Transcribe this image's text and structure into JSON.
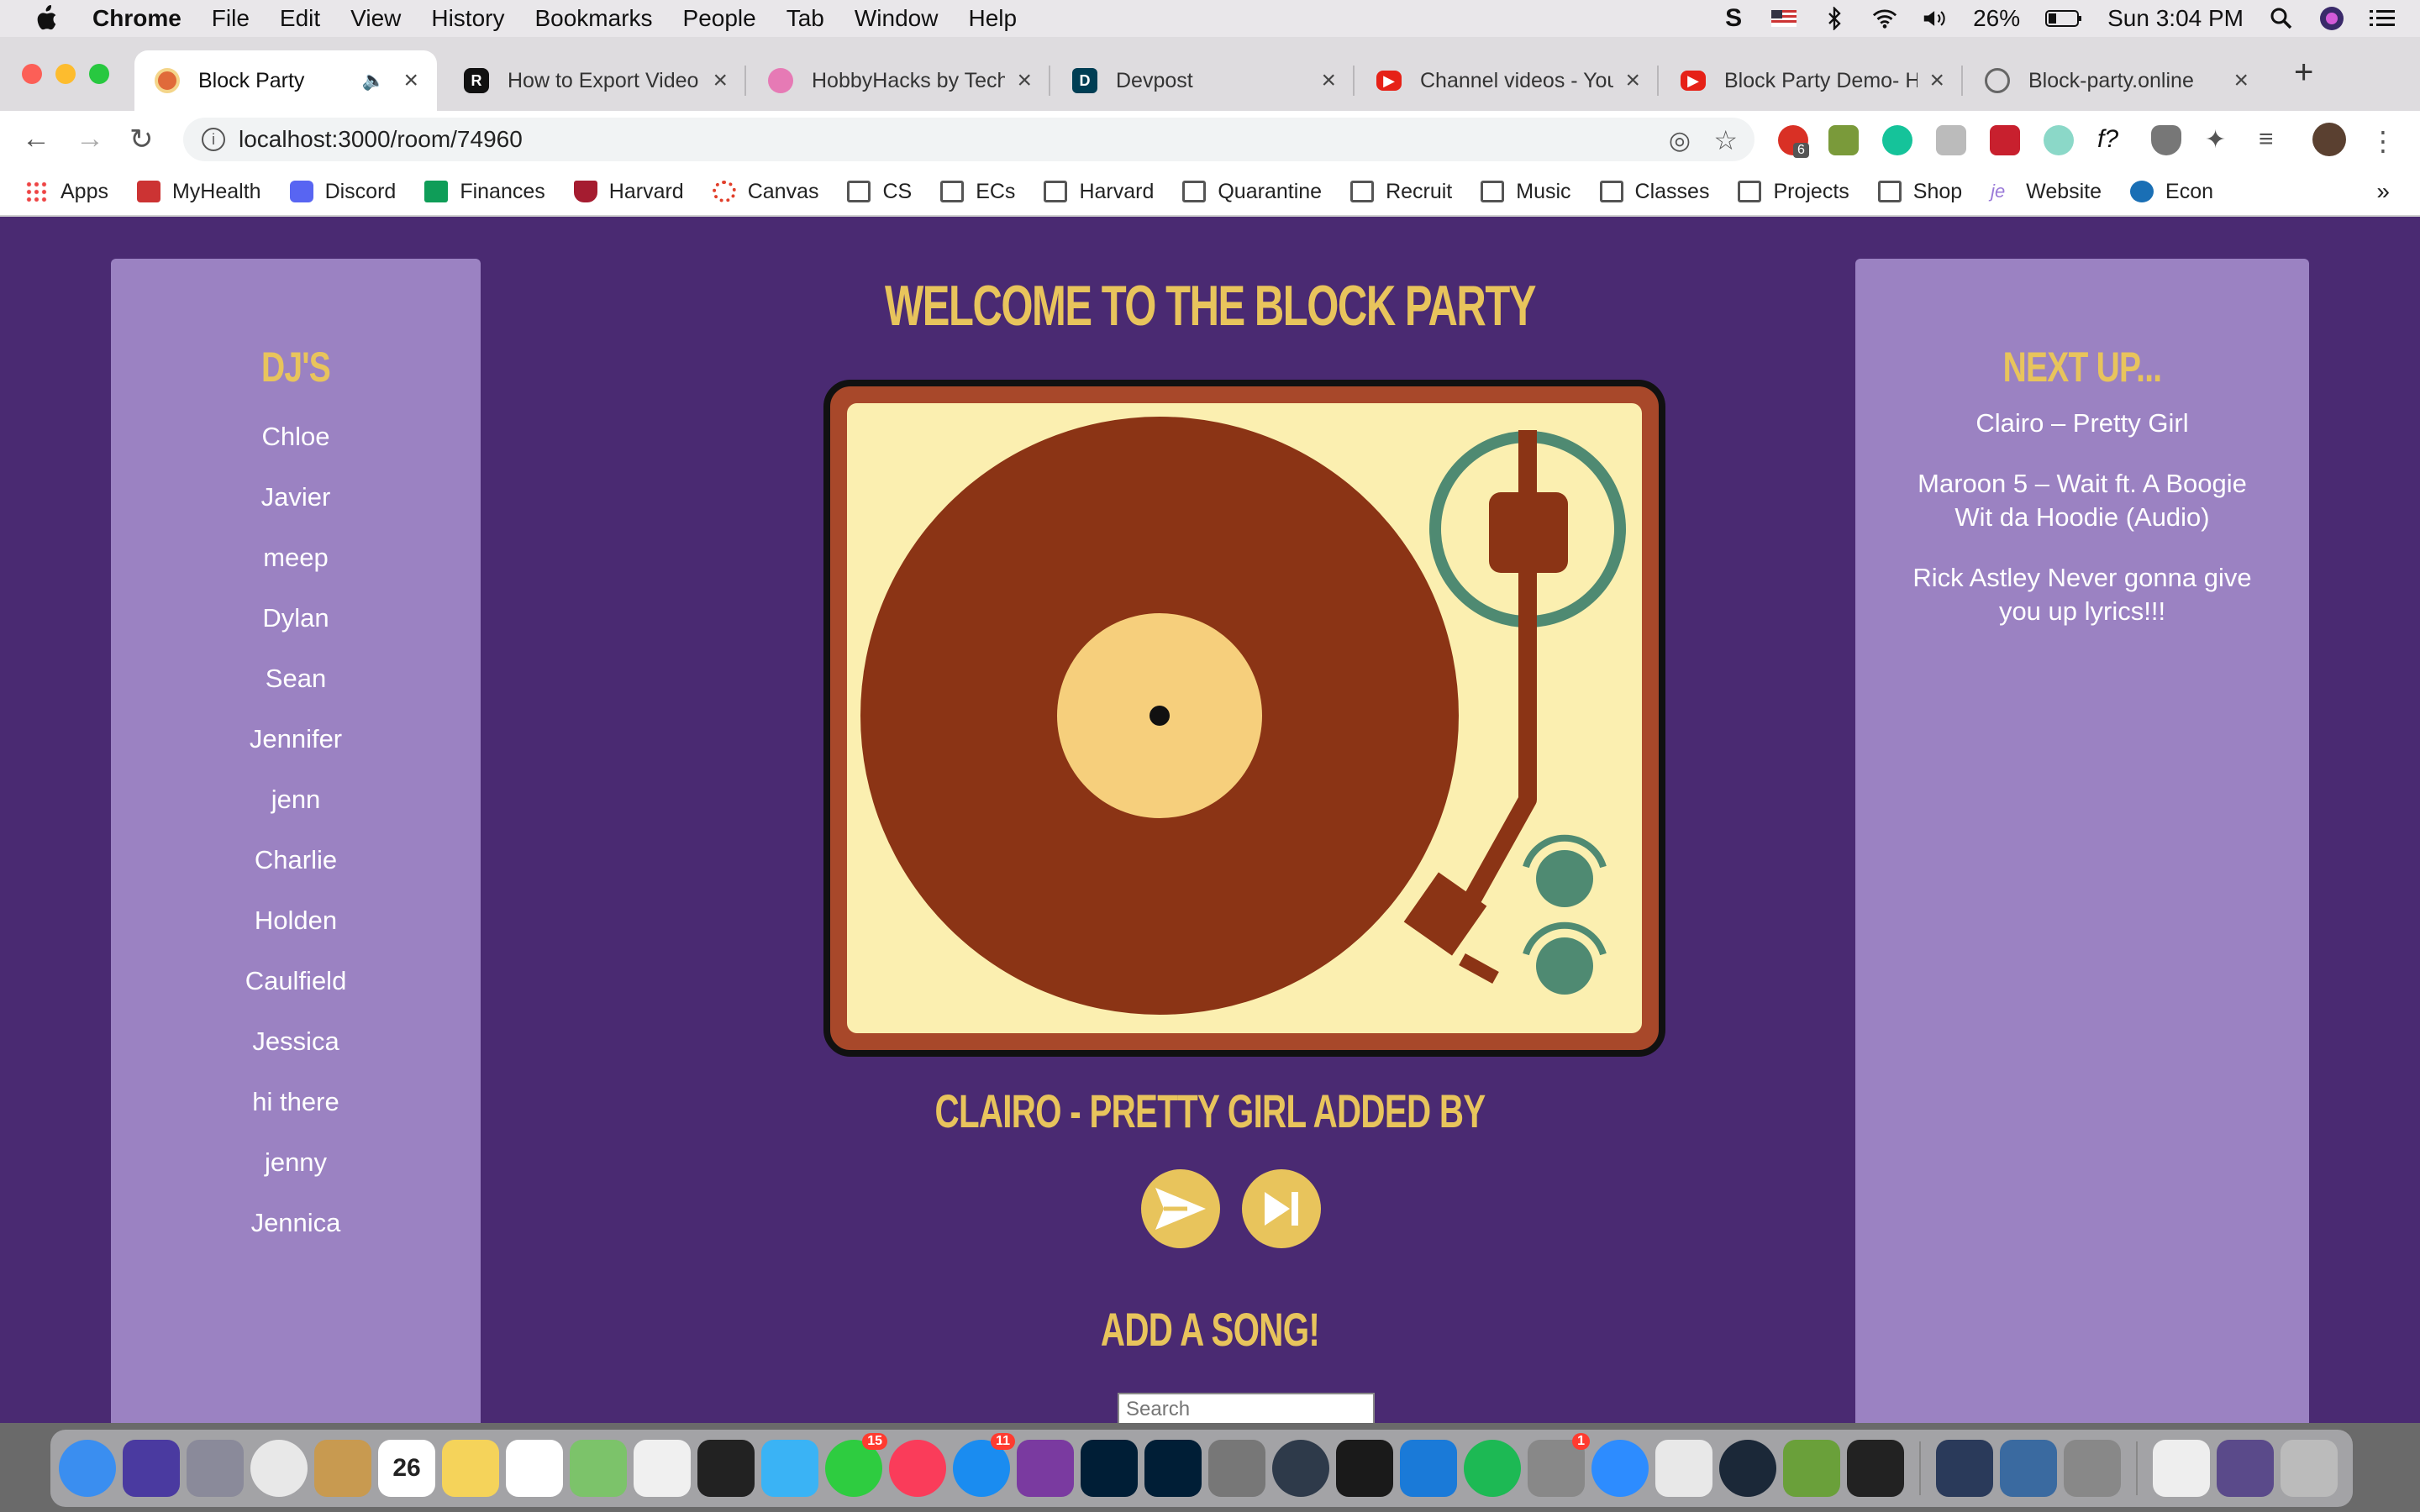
{
  "menubar": {
    "items": [
      "Chrome",
      "File",
      "Edit",
      "View",
      "History",
      "Bookmarks",
      "People",
      "Tab",
      "Window",
      "Help"
    ],
    "battery": "26%",
    "clock": "Sun 3:04 PM"
  },
  "tabs": [
    {
      "title": "Block Party",
      "icon": "block-party-icon",
      "color": "#e06a3a",
      "active": true
    },
    {
      "title": "How to Export Video",
      "icon": "premiere-icon",
      "color": "#111111"
    },
    {
      "title": "HobbyHacks by Tech",
      "icon": "hobbyhacks-icon",
      "color": "#e67ab5"
    },
    {
      "title": "Devpost",
      "icon": "devpost-icon",
      "color": "#003e54"
    },
    {
      "title": "Channel videos - You",
      "icon": "youtube-icon",
      "color": "#e62117"
    },
    {
      "title": "Block Party Demo- H",
      "icon": "youtube-icon",
      "color": "#e62117"
    },
    {
      "title": "Block-party.online",
      "icon": "globe-icon",
      "color": "#666666"
    }
  ],
  "toolbar": {
    "url": "localhost:3000/room/74960",
    "extension_badge": "6"
  },
  "bookmarks": [
    {
      "label": "Apps",
      "icon": "apps-grid-icon"
    },
    {
      "label": "MyHealth",
      "icon": "myhealth-icon"
    },
    {
      "label": "Discord",
      "icon": "discord-icon"
    },
    {
      "label": "Finances",
      "icon": "sheets-icon"
    },
    {
      "label": "Harvard",
      "icon": "harvard-icon"
    },
    {
      "label": "Canvas",
      "icon": "canvas-icon"
    },
    {
      "label": "CS",
      "icon": "folder-icon"
    },
    {
      "label": "ECs",
      "icon": "folder-icon"
    },
    {
      "label": "Harvard",
      "icon": "folder-icon"
    },
    {
      "label": "Quarantine",
      "icon": "folder-icon"
    },
    {
      "label": "Recruit",
      "icon": "folder-icon"
    },
    {
      "label": "Music",
      "icon": "folder-icon"
    },
    {
      "label": "Classes",
      "icon": "folder-icon"
    },
    {
      "label": "Projects",
      "icon": "folder-icon"
    },
    {
      "label": "Shop",
      "icon": "folder-icon"
    },
    {
      "label": "Website",
      "icon": "website-icon"
    },
    {
      "label": "Econ",
      "icon": "econ-icon"
    }
  ],
  "page": {
    "welcome": "WELCOME TO THE BLOCK PARTY",
    "djs_title": "DJ'S",
    "djs": [
      "Chloe",
      "Javier",
      "meep",
      "Dylan",
      "Sean",
      "Jennifer",
      "jenn",
      "Charlie",
      "Holden",
      "Caulfield",
      "Jessica",
      "hi there",
      "jenny",
      "Jennica"
    ],
    "next_up_title": "NEXT UP...",
    "queue": [
      "Clairo – Pretty Girl",
      "Maroon 5 – Wait ft. A Boogie Wit da Hoodie (Audio)",
      "Rick Astley Never gonna give you up lyrics!!!"
    ],
    "now_playing": "CLAIRO - PRETTY GIRL ADDED BY",
    "add_song": "ADD A SONG!",
    "search_placeholder": "Search"
  },
  "colors": {
    "background": "#4a2a72",
    "panel": "#9b82c2",
    "accent": "#e8c45c",
    "record": "#8b3415",
    "deck": "#fbefb0"
  },
  "dock_icons": [
    "finder-icon",
    "siri-icon",
    "launchpad-icon",
    "chrome-icon",
    "contacts-icon",
    "calendar-icon",
    "notes-icon",
    "reminders-icon",
    "maps-icon",
    "photos-icon",
    "final-cut-icon",
    "messages-icon",
    "facetime-icon",
    "music-icon",
    "app-store-icon",
    "onenote-icon",
    "photoshop-icon",
    "lightroom-icon",
    "disk-utility-icon",
    "atom-icon",
    "pycharm-icon",
    "xcode-icon",
    "spotify-icon",
    "system-preferences-icon",
    "zoom-icon",
    "slack-icon",
    "steam-icon",
    "minecraft-icon",
    "terminal-icon",
    "quicktime-icon",
    "preview-icon",
    "screenshot-icon",
    "music-file-icon",
    "screen-recording-icon",
    "trash-icon"
  ],
  "dock_badges": {
    "calendar_day": "26",
    "facetime": "15",
    "app_store": "11",
    "system_preferences": "1"
  }
}
